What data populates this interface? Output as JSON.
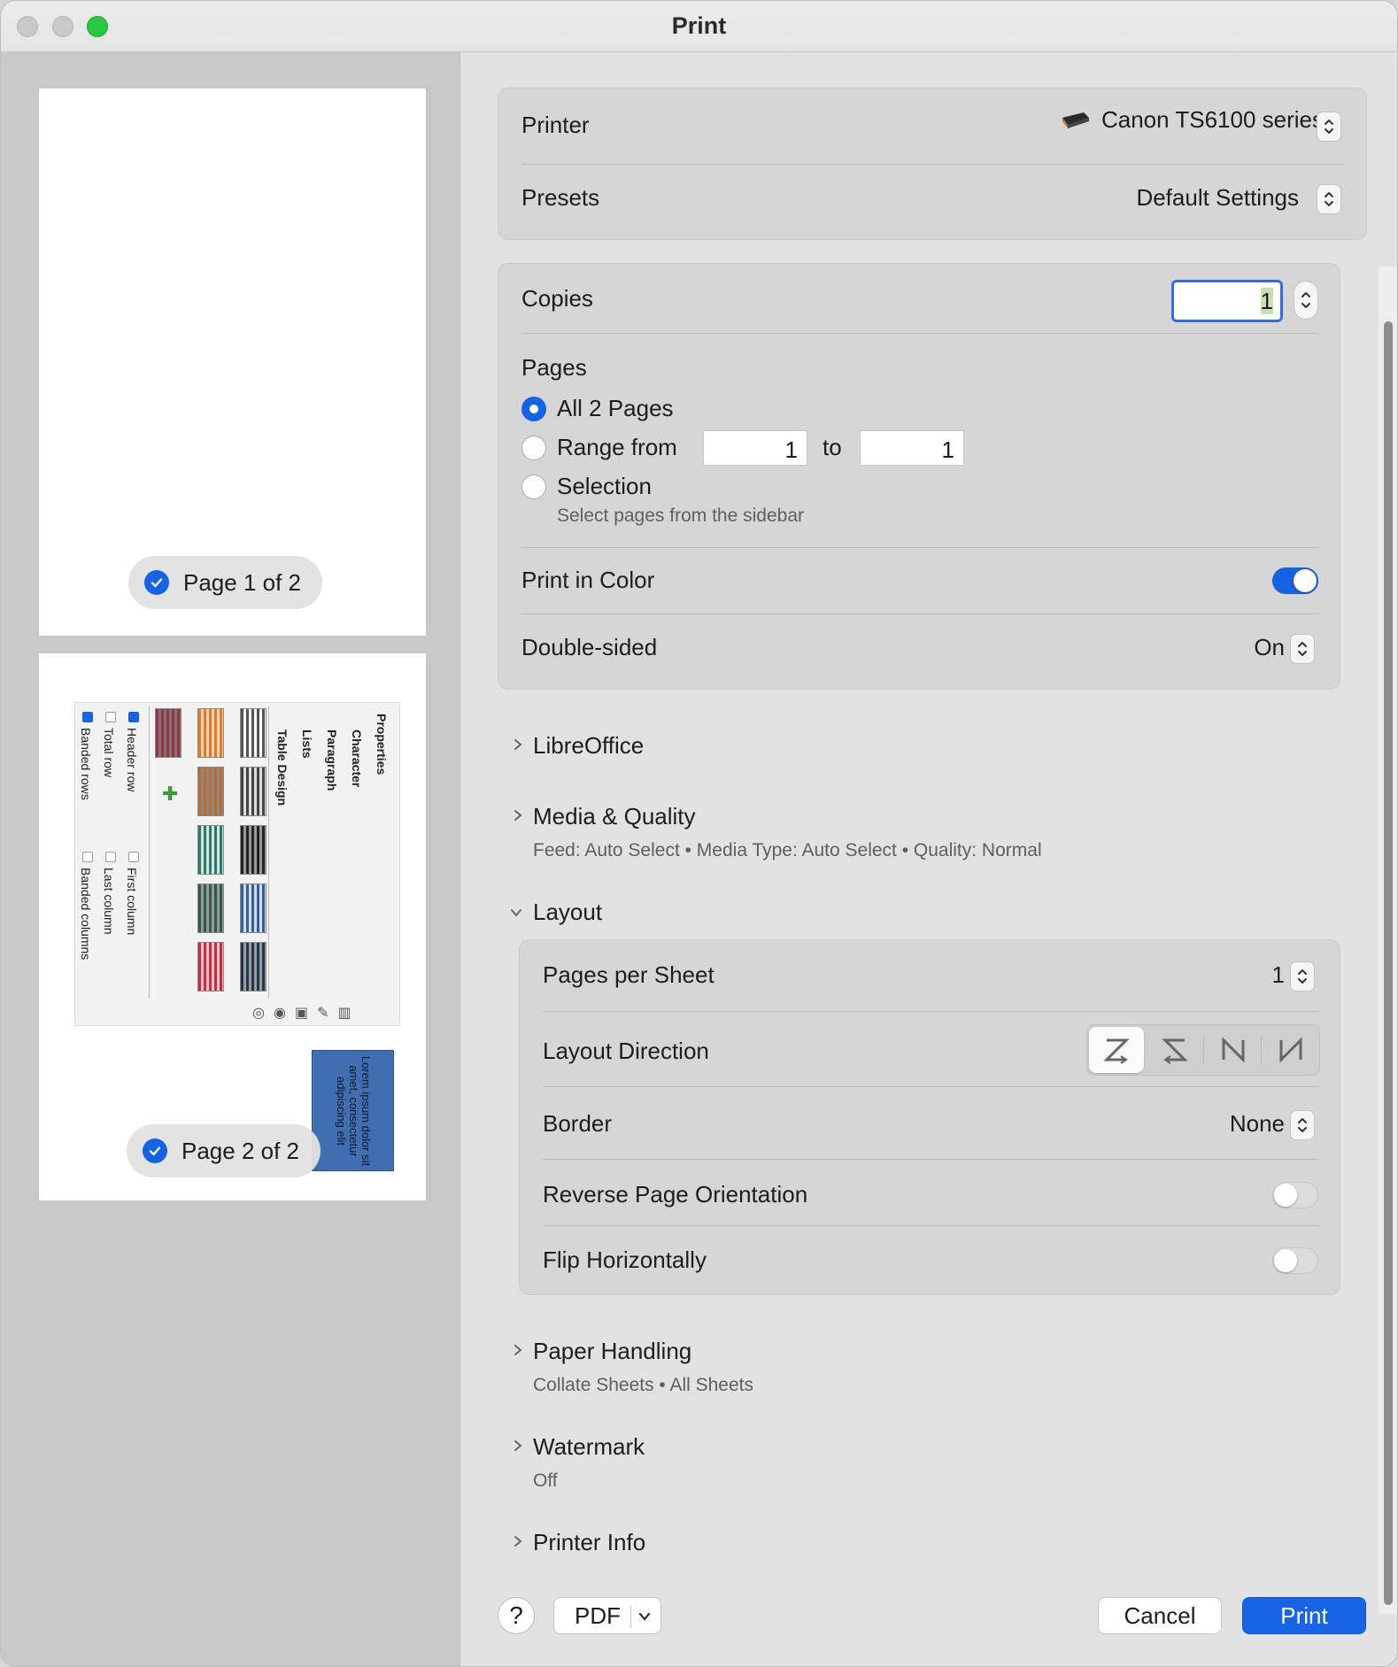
{
  "window": {
    "title": "Print"
  },
  "sidebar": {
    "pages": [
      {
        "badge": "Page 1 of 2"
      },
      {
        "badge": "Page 2 of 2"
      }
    ],
    "thumbnail": {
      "labels": [
        "Properties",
        "Character",
        "Paragraph",
        "Lists",
        "Table Design"
      ],
      "checkbox_labels": [
        "Header row",
        "Total row",
        "Banded rows",
        "First column",
        "Last column",
        "Banded columns"
      ],
      "blue_text": "Lorem ipsum dolor sit amet, consectetur adipiscing elit"
    }
  },
  "printer_card": {
    "printer_label": "Printer",
    "printer_value": "Canon TS6100 series",
    "presets_label": "Presets",
    "presets_value": "Default Settings"
  },
  "copies_card": {
    "copies_label": "Copies",
    "copies_value": "1",
    "pages_label": "Pages",
    "all_pages_label": "All 2 Pages",
    "range_label": "Range from",
    "range_from": "1",
    "range_to_label": "to",
    "range_to": "1",
    "selection_label": "Selection",
    "selection_hint": "Select pages from the sidebar",
    "print_color_label": "Print in Color",
    "double_sided_label": "Double-sided",
    "double_sided_value": "On"
  },
  "sections": {
    "libreoffice": "LibreOffice",
    "media_quality": "Media & Quality",
    "media_quality_summary": "Feed: Auto Select • Media Type: Auto Select • Quality: Normal",
    "layout": "Layout",
    "paper_handling": "Paper Handling",
    "paper_handling_summary": "Collate Sheets • All Sheets",
    "watermark": "Watermark",
    "watermark_summary": "Off",
    "printer_info": "Printer Info"
  },
  "layout_card": {
    "pages_per_sheet_label": "Pages per Sheet",
    "pages_per_sheet_value": "1",
    "layout_direction_label": "Layout Direction",
    "border_label": "Border",
    "border_value": "None",
    "reverse_label": "Reverse Page Orientation",
    "flip_label": "Flip Horizontally"
  },
  "footer": {
    "help_label": "?",
    "pdf_label": "PDF",
    "cancel_label": "Cancel",
    "print_label": "Print"
  },
  "colors": {
    "accent": "#1463e6",
    "maximize": "#28c840"
  }
}
